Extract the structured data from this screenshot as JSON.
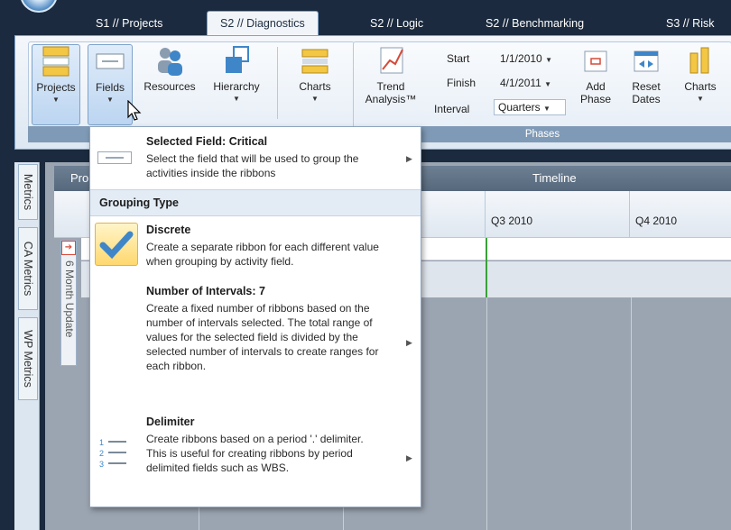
{
  "tabs": [
    {
      "label": "S1 // Projects"
    },
    {
      "label": "S2 // Diagnostics"
    },
    {
      "label": "S2 // Logic"
    },
    {
      "label": "S2 // Benchmarking"
    },
    {
      "label": "S3 // Risk"
    }
  ],
  "ribbon": {
    "projects": "Projects",
    "fields": "Fields",
    "resources": "Resources",
    "hierarchy": "Hierarchy",
    "charts": "Charts",
    "trend": "Trend",
    "trend2": "Analysis™",
    "start_label": "Start",
    "start_value": "1/1/2010",
    "finish_label": "Finish",
    "finish_value": "4/1/2011",
    "interval_label": "Interval",
    "interval_value": "Quarters",
    "add": "Add",
    "add2": "Phase",
    "reset": "Reset",
    "reset2": "Dates",
    "charts2": "Charts",
    "phases_group": "Phases"
  },
  "side_tabs": [
    "Metrics",
    "CA Metrics",
    "WP Metrics"
  ],
  "timeline": {
    "header": "Timeline",
    "col_prefix": "Pro",
    "q3": "Q3 2010",
    "q4": "Q4 2010",
    "row_label": "6 Month Update"
  },
  "popup": {
    "selected_title": "Selected Field: Critical",
    "selected_desc": "Select the field that will be used to group the activities inside the ribbons",
    "section": "Grouping Type",
    "discrete_title": "Discrete",
    "discrete_desc": "Create a separate ribbon for each different value when grouping by activity field.",
    "intervals_title": "Number of Intervals: 7",
    "intervals_desc": "Create a fixed number of ribbons based on the number of intervals selected. The total range of values for the selected field is divided by the selected number of intervals to create ranges for each ribbon.",
    "delim_title": "Delimiter",
    "delim_desc": "Create ribbons based on a period '.' delimiter. This is useful for creating ribbons by period delimited fields such as WBS."
  },
  "colors": {
    "accent": "#3f86c8",
    "selected": "#ffd86e"
  }
}
